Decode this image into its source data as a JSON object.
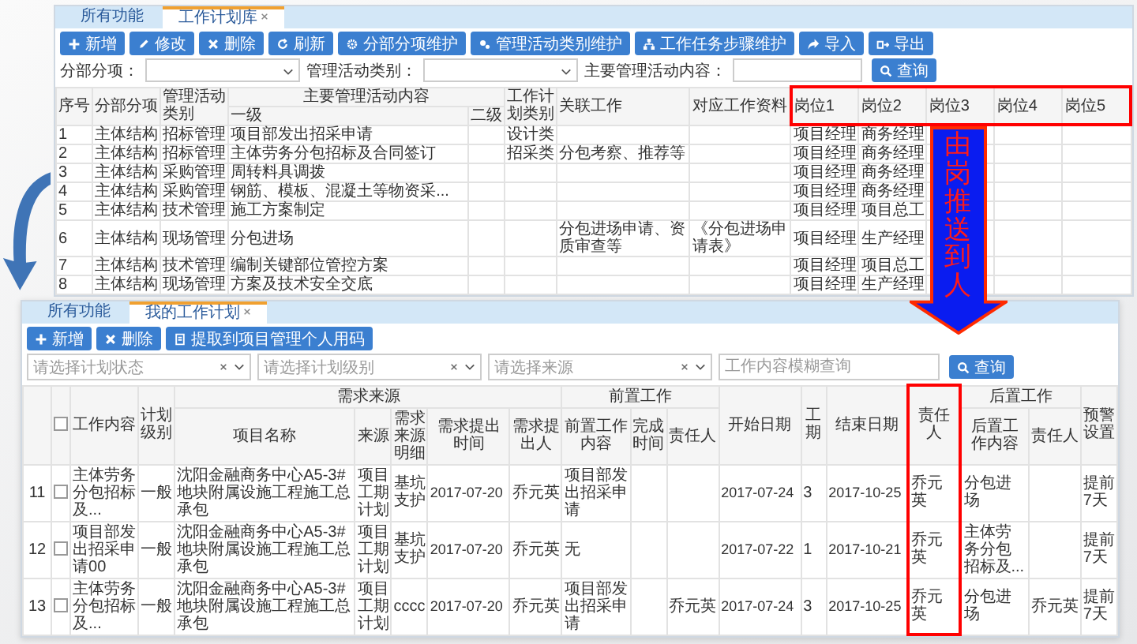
{
  "top_window": {
    "tabs": [
      {
        "label": "所有功能",
        "selected": false
      },
      {
        "label": "工作计划库",
        "selected": true,
        "closable": true
      }
    ],
    "toolbar": [
      {
        "label": "新增",
        "kind": "plus"
      },
      {
        "label": "修改",
        "kind": "pencil"
      },
      {
        "label": "删除",
        "kind": "times"
      },
      {
        "label": "刷新",
        "kind": "refresh"
      },
      {
        "label": "分部分项维护",
        "kind": "gear"
      },
      {
        "label": "管理活动类别维护",
        "kind": "gears"
      },
      {
        "label": "工作任务步骤维护",
        "kind": "sitemap"
      },
      {
        "label": "导入",
        "kind": "share"
      },
      {
        "label": "导出",
        "kind": "export"
      }
    ],
    "filters": [
      {
        "label": "分部分项：",
        "kind": "select"
      },
      {
        "label": "管理活动类别：",
        "kind": "select"
      },
      {
        "label": "主要管理活动内容：",
        "kind": "input"
      }
    ],
    "search_button": "查询",
    "table": {
      "column_groups": [
        {
          "label": "主要管理活动内容",
          "colspan": 2
        }
      ],
      "columns": [
        {
          "label": "序号"
        },
        {
          "label": "分部分项"
        },
        {
          "label": "管理活动类别"
        },
        {
          "label": "一级",
          "group_start": true
        },
        {
          "label": "二级",
          "in_group": true
        },
        {
          "label": "工作计划类别"
        },
        {
          "label": "关联工作"
        },
        {
          "label": "对应工作资料"
        },
        {
          "label": "岗位1",
          "highlighted": true
        },
        {
          "label": "岗位2",
          "highlighted": true
        },
        {
          "label": "岗位3",
          "highlighted": true
        },
        {
          "label": "岗位4",
          "highlighted": true
        },
        {
          "label": "岗位5",
          "highlighted": true
        }
      ],
      "rows": [
        [
          "1",
          "主体结构",
          "招标管理",
          "项目部发出招采申请",
          null,
          "设计类",
          null,
          null,
          "项目经理",
          "商务经理",
          null,
          null,
          null
        ],
        [
          "2",
          "主体结构",
          "招标管理",
          "主体劳务分包招标及合同签订",
          null,
          "招采类",
          "分包考察、推荐等",
          null,
          "项目经理",
          "商务经理",
          null,
          null,
          null
        ],
        [
          "3",
          "主体结构",
          "采购管理",
          "周转料具调拨",
          null,
          null,
          null,
          null,
          "项目经理",
          "商务经理",
          null,
          null,
          null
        ],
        [
          "4",
          "主体结构",
          "采购管理",
          "钢筋、模板、混凝土等物资采...",
          null,
          null,
          null,
          null,
          "项目经理",
          "商务经理",
          null,
          null,
          null
        ],
        [
          "5",
          "主体结构",
          "技术管理",
          "施工方案制定",
          null,
          null,
          null,
          null,
          "项目经理",
          "项目总工",
          null,
          null,
          null
        ],
        [
          "6",
          "主体结构",
          "现场管理",
          "分包进场",
          null,
          null,
          "分包进场申请、资质审查等",
          "《分包进场申请表》",
          "项目经理",
          "生产经理",
          null,
          null,
          null
        ],
        [
          "7",
          "主体结构",
          "技术管理",
          "编制关键部位管控方案",
          null,
          null,
          null,
          null,
          "项目经理",
          "项目总工",
          null,
          null,
          null
        ],
        [
          "8",
          "主体结构",
          "现场管理",
          "方案及技术安全交底",
          null,
          null,
          null,
          null,
          "项目经理",
          "生产经理",
          null,
          null,
          null
        ]
      ]
    }
  },
  "arrow_label": "由岗推送到人",
  "bottom_window": {
    "tabs": [
      {
        "label": "所有功能",
        "selected": false
      },
      {
        "label": "我的工作计划",
        "selected": true,
        "closable": true
      }
    ],
    "toolbar": [
      {
        "label": "新增",
        "kind": "plus"
      },
      {
        "label": "删除",
        "kind": "times"
      },
      {
        "label": "提取到项目管理个人用码",
        "kind": "doc"
      }
    ],
    "filters": [
      {
        "placeholder": "请选择计划状态",
        "kind": "select"
      },
      {
        "placeholder": "请选择计划级别",
        "kind": "select"
      },
      {
        "placeholder": "请选择来源",
        "kind": "select"
      },
      {
        "placeholder": "工作内容模糊查询",
        "kind": "input"
      }
    ],
    "search_button": "查询",
    "table": {
      "select_all": {
        "checked": false
      },
      "column_groups": [
        {
          "label": "需求来源",
          "colspan": 5
        },
        {
          "label": "前置工作",
          "colspan": 3
        },
        {
          "label": "后置工作",
          "colspan": 2
        }
      ],
      "columns": [
        {
          "label": "工作内容"
        },
        {
          "label": "计划级别"
        },
        {
          "label": "项目名称",
          "group_start": true
        },
        {
          "label": "来源",
          "in_group": true
        },
        {
          "label": "需求来源明细",
          "in_group": true
        },
        {
          "label": "需求提出时间",
          "in_group": true
        },
        {
          "label": "需求提出人",
          "in_group": true
        },
        {
          "label": "前置工作内容",
          "group_start": true
        },
        {
          "label": "完成时间",
          "in_group": true
        },
        {
          "label": "责任人",
          "in_group": true
        },
        {
          "label": "开始日期"
        },
        {
          "label": "工期"
        },
        {
          "label": "结束日期"
        },
        {
          "label": "责任人",
          "highlighted": true
        },
        {
          "label": "后置工作内容",
          "group_start": true
        },
        {
          "label": "责任人",
          "in_group": true
        },
        {
          "label": "预警设置"
        }
      ],
      "rows": [
        {
          "num": "11",
          "checked": false,
          "cells": [
            "主体劳务分包招标及...",
            "一般",
            "沈阳金融商务中心A5-3#地块附属设施工程施工总承包",
            "项目工期计划",
            "基坑支护",
            "2017-07-20",
            "乔元英",
            "项目部发出招采申请",
            null,
            null,
            "2017-07-24",
            "3",
            "2017-10-25",
            "乔元英",
            "分包进场",
            null,
            "提前7天"
          ]
        },
        {
          "num": "12",
          "checked": false,
          "cells": [
            "项目部发出招采申请00",
            "一般",
            "沈阳金融商务中心A5-3#地块附属设施工程施工总承包",
            "项目工期计划",
            "基坑支护",
            "2017-07-20",
            "乔元英",
            "无",
            null,
            null,
            "2017-07-22",
            "1",
            "2017-10-21",
            "乔元英",
            "主体劳务分包招标及...",
            null,
            "提前7天"
          ]
        },
        {
          "num": "13",
          "checked": false,
          "cells": [
            "主体劳务分包招标及...",
            "一般",
            "沈阳金融商务中心A5-3#地块附属设施工程施工总承包",
            "项目工期计划",
            "cccc",
            "2017-07-20",
            "乔元英",
            "项目部发出招采申请",
            null,
            "乔元英",
            "2017-07-24",
            "3",
            "2017-10-25",
            "乔元英",
            "分包进场",
            "乔元英",
            "提前7天"
          ]
        }
      ]
    }
  }
}
